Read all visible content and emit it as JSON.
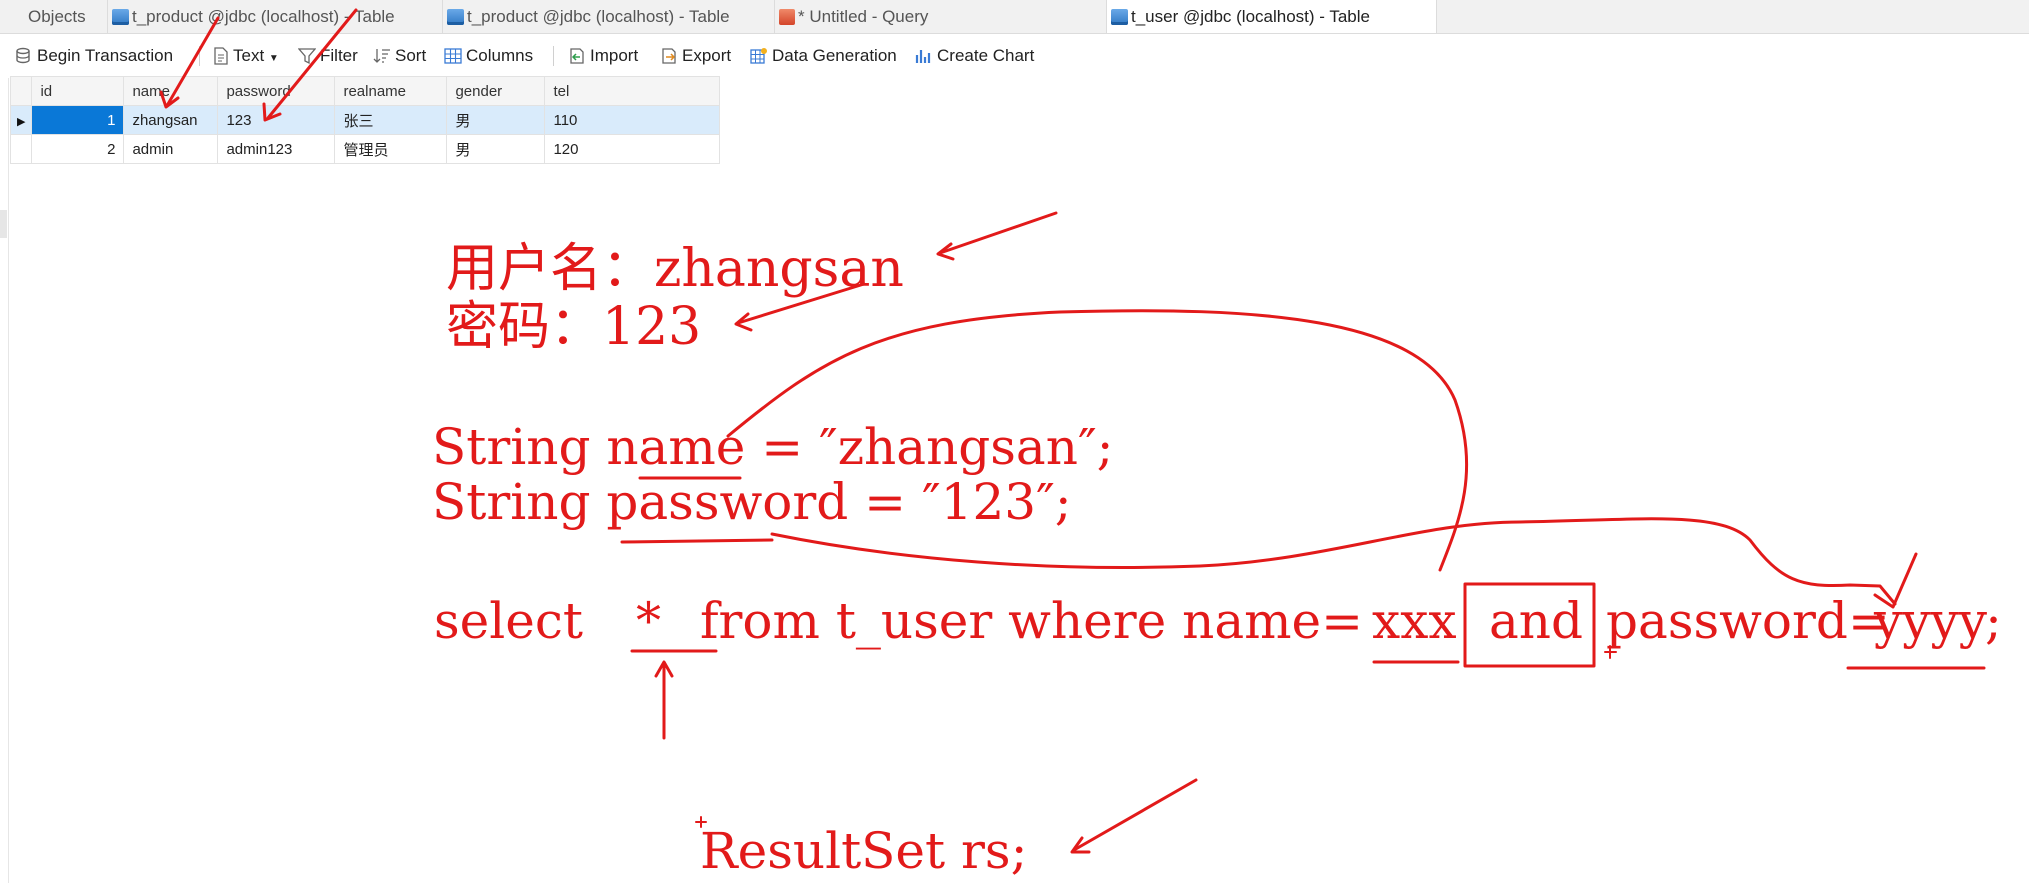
{
  "tabs": [
    {
      "label": "Objects",
      "icon": "objects-icon",
      "active": false
    },
    {
      "label": "t_product @jdbc (localhost) - Table",
      "icon": "table-icon",
      "active": false
    },
    {
      "label": "t_product @jdbc (localhost) - Table",
      "icon": "table-edit-icon",
      "active": false
    },
    {
      "label": "* Untitled - Query",
      "icon": "query-icon",
      "active": false
    },
    {
      "label": "t_user @jdbc (localhost) - Table",
      "icon": "table-icon",
      "active": true
    }
  ],
  "toolbar": {
    "begin_transaction": "Begin Transaction",
    "text": "Text",
    "filter": "Filter",
    "sort": "Sort",
    "columns": "Columns",
    "import": "Import",
    "export": "Export",
    "data_generation": "Data Generation",
    "create_chart": "Create Chart"
  },
  "table": {
    "columns": [
      "id",
      "name",
      "password",
      "realname",
      "gender",
      "tel"
    ],
    "rows": [
      {
        "id": "1",
        "name": "zhangsan",
        "password": "123",
        "realname": "张三",
        "gender": "男",
        "tel": "110"
      },
      {
        "id": "2",
        "name": "admin",
        "password": "admin123",
        "realname": "管理员",
        "gender": "男",
        "tel": "120"
      }
    ],
    "selected_row": 0
  },
  "annotations": {
    "username_line": "用户名：zhangsan",
    "password_line": "密码：123",
    "code_name": "String name = ″zhangsan″;",
    "code_password": "String password = ″123″;",
    "sql_select": "select",
    "sql_star": "*",
    "sql_from": "from t_user where name=",
    "sql_xxx": "xxx",
    "sql_and": "and",
    "sql_password": "password=",
    "sql_yyyy": "yyyy",
    "sql_semicolon": ";",
    "resultset": "ResultSet rs;"
  },
  "colors": {
    "annotation_red": "#e21a1a",
    "selection_blue": "#0a78d7",
    "row_highlight": "#d9ebfb"
  }
}
